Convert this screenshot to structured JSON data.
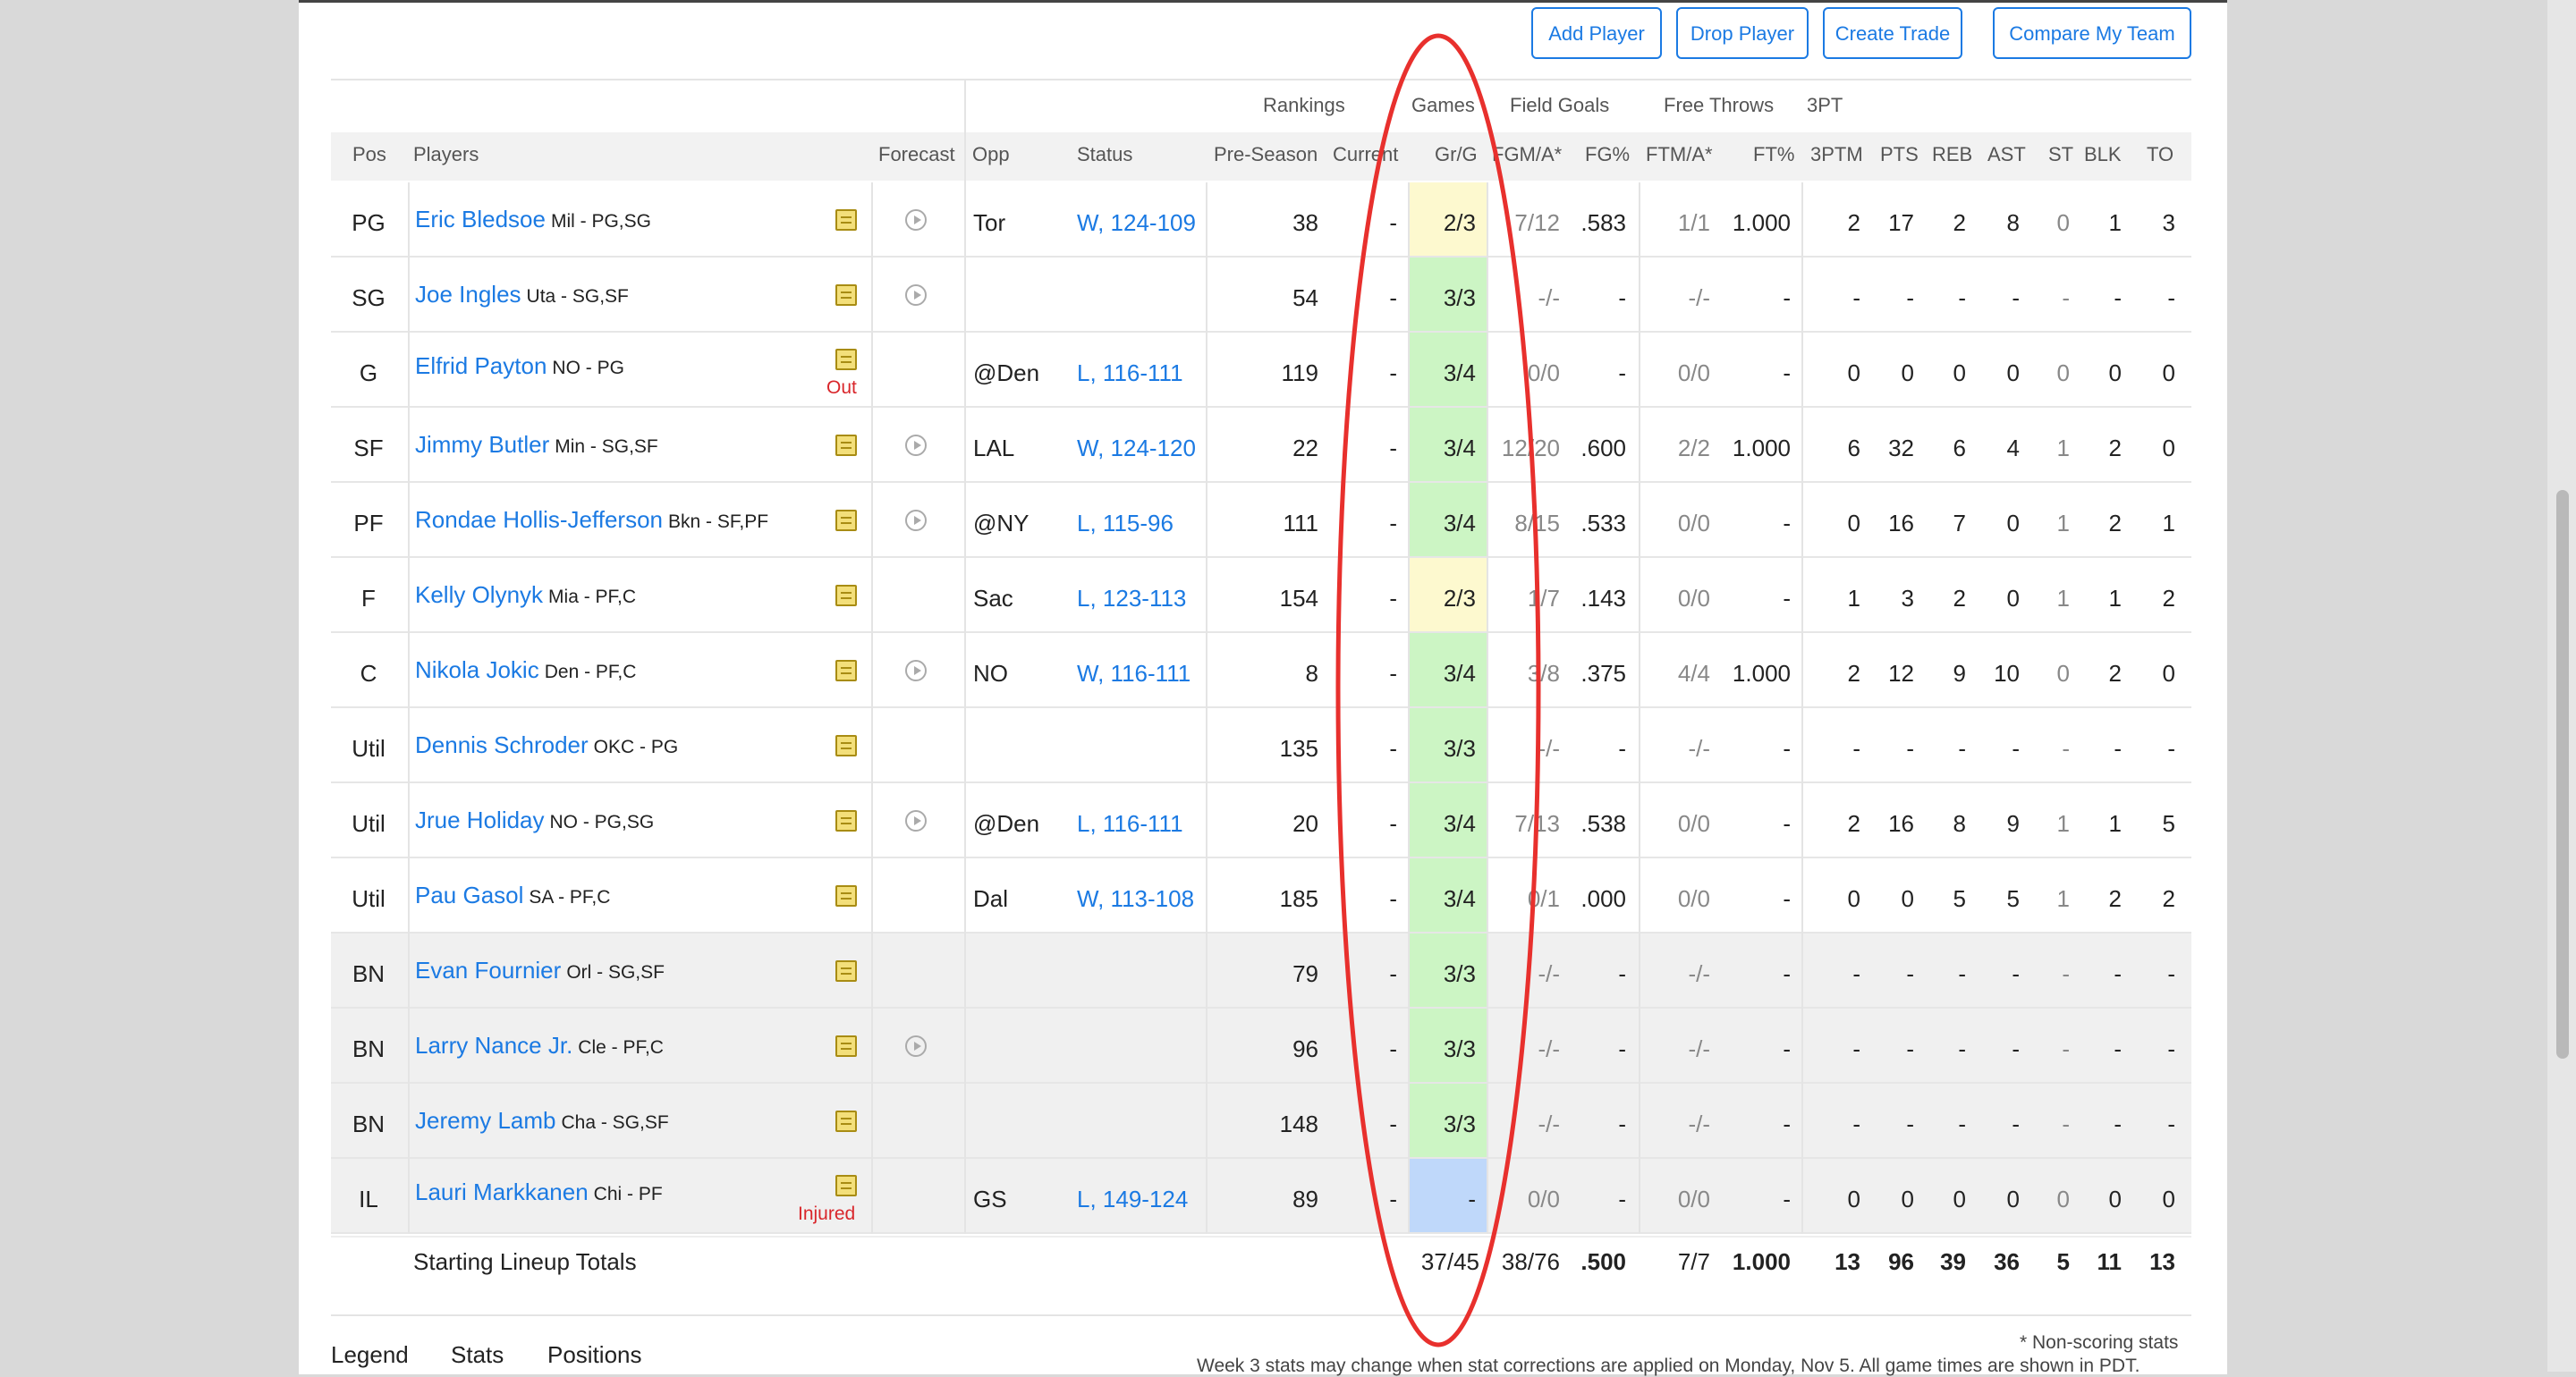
{
  "actions": {
    "add_player": "Add Player",
    "drop_player": "Drop Player",
    "create_trade": "Create Trade",
    "compare_team": "Compare My Team"
  },
  "group_headers": {
    "rankings": "Rankings",
    "games": "Games",
    "field_goals": "Field Goals",
    "free_throws": "Free Throws",
    "three_pt": "3PT"
  },
  "columns": {
    "pos": "Pos",
    "players": "Players",
    "forecast": "Forecast",
    "opp": "Opp",
    "status": "Status",
    "preseason": "Pre-Season",
    "current": "Current",
    "grg": "Gr/G",
    "fgma": "FGM/A*",
    "fgpct": "FG%",
    "ftma": "FTM/A*",
    "ftpct": "FT%",
    "threeptm": "3PTM",
    "pts": "PTS",
    "reb": "REB",
    "ast": "AST",
    "st": "ST",
    "blk": "BLK",
    "to": "TO"
  },
  "rows": [
    {
      "pos": "PG",
      "name": "Eric Bledsoe",
      "meta": "Mil - PG,SG",
      "flag": "",
      "forecast": true,
      "opp": "Tor",
      "status": "W, 124-109",
      "pre": "38",
      "cur": "-",
      "gr": "2/3",
      "gr_color": "yellow",
      "fgma": "7/12",
      "fgp": ".583",
      "ftma": "1/1",
      "ftp": "1.000",
      "tpm": "2",
      "pts": "17",
      "reb": "2",
      "ast": "8",
      "st": "0",
      "blk": "1",
      "to": "3"
    },
    {
      "pos": "SG",
      "name": "Joe Ingles",
      "meta": "Uta - SG,SF",
      "flag": "",
      "forecast": true,
      "opp": "",
      "status": "",
      "pre": "54",
      "cur": "-",
      "gr": "3/3",
      "gr_color": "green",
      "fgma": "-/-",
      "fgp": "-",
      "ftma": "-/-",
      "ftp": "-",
      "tpm": "-",
      "pts": "-",
      "reb": "-",
      "ast": "-",
      "st": "-",
      "blk": "-",
      "to": "-"
    },
    {
      "pos": "G",
      "name": "Elfrid Payton",
      "meta": "NO - PG",
      "flag": "Out",
      "forecast": false,
      "opp": "@Den",
      "status": "L, 116-111",
      "pre": "119",
      "cur": "-",
      "gr": "3/4",
      "gr_color": "green",
      "fgma": "0/0",
      "fgp": "-",
      "ftma": "0/0",
      "ftp": "-",
      "tpm": "0",
      "pts": "0",
      "reb": "0",
      "ast": "0",
      "st": "0",
      "blk": "0",
      "to": "0"
    },
    {
      "pos": "SF",
      "name": "Jimmy Butler",
      "meta": "Min - SG,SF",
      "flag": "",
      "forecast": true,
      "opp": "LAL",
      "status": "W, 124-120",
      "pre": "22",
      "cur": "-",
      "gr": "3/4",
      "gr_color": "green",
      "fgma": "12/20",
      "fgp": ".600",
      "ftma": "2/2",
      "ftp": "1.000",
      "tpm": "6",
      "pts": "32",
      "reb": "6",
      "ast": "4",
      "st": "1",
      "blk": "2",
      "to": "0"
    },
    {
      "pos": "PF",
      "name": "Rondae Hollis-Jefferson",
      "meta": "Bkn - SF,PF",
      "flag": "",
      "forecast": true,
      "opp": "@NY",
      "status": "L, 115-96",
      "pre": "111",
      "cur": "-",
      "gr": "3/4",
      "gr_color": "green",
      "fgma": "8/15",
      "fgp": ".533",
      "ftma": "0/0",
      "ftp": "-",
      "tpm": "0",
      "pts": "16",
      "reb": "7",
      "ast": "0",
      "st": "1",
      "blk": "2",
      "to": "1"
    },
    {
      "pos": "F",
      "name": "Kelly Olynyk",
      "meta": "Mia - PF,C",
      "flag": "",
      "forecast": false,
      "opp": "Sac",
      "status": "L, 123-113",
      "pre": "154",
      "cur": "-",
      "gr": "2/3",
      "gr_color": "yellow",
      "fgma": "1/7",
      "fgp": ".143",
      "ftma": "0/0",
      "ftp": "-",
      "tpm": "1",
      "pts": "3",
      "reb": "2",
      "ast": "0",
      "st": "1",
      "blk": "1",
      "to": "2"
    },
    {
      "pos": "C",
      "name": "Nikola Jokic",
      "meta": "Den - PF,C",
      "flag": "",
      "forecast": true,
      "opp": "NO",
      "status": "W, 116-111",
      "pre": "8",
      "cur": "-",
      "gr": "3/4",
      "gr_color": "green",
      "fgma": "3/8",
      "fgp": ".375",
      "ftma": "4/4",
      "ftp": "1.000",
      "tpm": "2",
      "pts": "12",
      "reb": "9",
      "ast": "10",
      "st": "0",
      "blk": "2",
      "to": "0"
    },
    {
      "pos": "Util",
      "name": "Dennis Schroder",
      "meta": "OKC - PG",
      "flag": "",
      "forecast": false,
      "opp": "",
      "status": "",
      "pre": "135",
      "cur": "-",
      "gr": "3/3",
      "gr_color": "green",
      "fgma": "-/-",
      "fgp": "-",
      "ftma": "-/-",
      "ftp": "-",
      "tpm": "-",
      "pts": "-",
      "reb": "-",
      "ast": "-",
      "st": "-",
      "blk": "-",
      "to": "-"
    },
    {
      "pos": "Util",
      "name": "Jrue Holiday",
      "meta": "NO - PG,SG",
      "flag": "",
      "forecast": true,
      "opp": "@Den",
      "status": "L, 116-111",
      "pre": "20",
      "cur": "-",
      "gr": "3/4",
      "gr_color": "green",
      "fgma": "7/13",
      "fgp": ".538",
      "ftma": "0/0",
      "ftp": "-",
      "tpm": "2",
      "pts": "16",
      "reb": "8",
      "ast": "9",
      "st": "1",
      "blk": "1",
      "to": "5"
    },
    {
      "pos": "Util",
      "name": "Pau Gasol",
      "meta": "SA - PF,C",
      "flag": "",
      "forecast": false,
      "opp": "Dal",
      "status": "W, 113-108",
      "pre": "185",
      "cur": "-",
      "gr": "3/4",
      "gr_color": "green",
      "fgma": "0/1",
      "fgp": ".000",
      "ftma": "0/0",
      "ftp": "-",
      "tpm": "0",
      "pts": "0",
      "reb": "5",
      "ast": "5",
      "st": "1",
      "blk": "2",
      "to": "2"
    },
    {
      "pos": "BN",
      "name": "Evan Fournier",
      "meta": "Orl - SG,SF",
      "flag": "",
      "forecast": false,
      "opp": "",
      "status": "",
      "pre": "79",
      "cur": "-",
      "gr": "3/3",
      "gr_color": "green",
      "fgma": "-/-",
      "fgp": "-",
      "ftma": "-/-",
      "ftp": "-",
      "tpm": "-",
      "pts": "-",
      "reb": "-",
      "ast": "-",
      "st": "-",
      "blk": "-",
      "to": "-"
    },
    {
      "pos": "BN",
      "name": "Larry Nance Jr.",
      "meta": "Cle - PF,C",
      "flag": "",
      "forecast": true,
      "opp": "",
      "status": "",
      "pre": "96",
      "cur": "-",
      "gr": "3/3",
      "gr_color": "green",
      "fgma": "-/-",
      "fgp": "-",
      "ftma": "-/-",
      "ftp": "-",
      "tpm": "-",
      "pts": "-",
      "reb": "-",
      "ast": "-",
      "st": "-",
      "blk": "-",
      "to": "-"
    },
    {
      "pos": "BN",
      "name": "Jeremy Lamb",
      "meta": "Cha - SG,SF",
      "flag": "",
      "forecast": false,
      "opp": "",
      "status": "",
      "pre": "148",
      "cur": "-",
      "gr": "3/3",
      "gr_color": "green",
      "fgma": "-/-",
      "fgp": "-",
      "ftma": "-/-",
      "ftp": "-",
      "tpm": "-",
      "pts": "-",
      "reb": "-",
      "ast": "-",
      "st": "-",
      "blk": "-",
      "to": "-"
    },
    {
      "pos": "IL",
      "name": "Lauri Markkanen",
      "meta": "Chi - PF",
      "flag": "Injured",
      "forecast": false,
      "opp": "GS",
      "status": "L, 149-124",
      "pre": "89",
      "cur": "-",
      "gr": "-",
      "gr_color": "blue",
      "fgma": "0/0",
      "fgp": "-",
      "ftma": "0/0",
      "ftp": "-",
      "tpm": "0",
      "pts": "0",
      "reb": "0",
      "ast": "0",
      "st": "0",
      "blk": "0",
      "to": "0"
    }
  ],
  "totals": {
    "label": "Starting Lineup Totals",
    "gr": "37/45",
    "fgma": "38/76",
    "fgp": ".500",
    "ftma": "7/7",
    "ftp": "1.000",
    "tpm": "13",
    "pts": "96",
    "reb": "39",
    "ast": "36",
    "st": "5",
    "blk": "11",
    "to": "13"
  },
  "footer": {
    "tabs": [
      "Legend",
      "Stats",
      "Positions"
    ],
    "nonscoring": "* Non-scoring stats",
    "week_note": "Week 3 stats may change when stat corrections are applied on Monday, Nov 5. All game times are shown in PDT."
  },
  "colors": {
    "link": "#1b7ae3",
    "highlight_oval": "#e8302d",
    "games_green": "#ccf5c4",
    "games_yellow": "#fdf9cf",
    "games_blue": "#bfd8fa"
  }
}
